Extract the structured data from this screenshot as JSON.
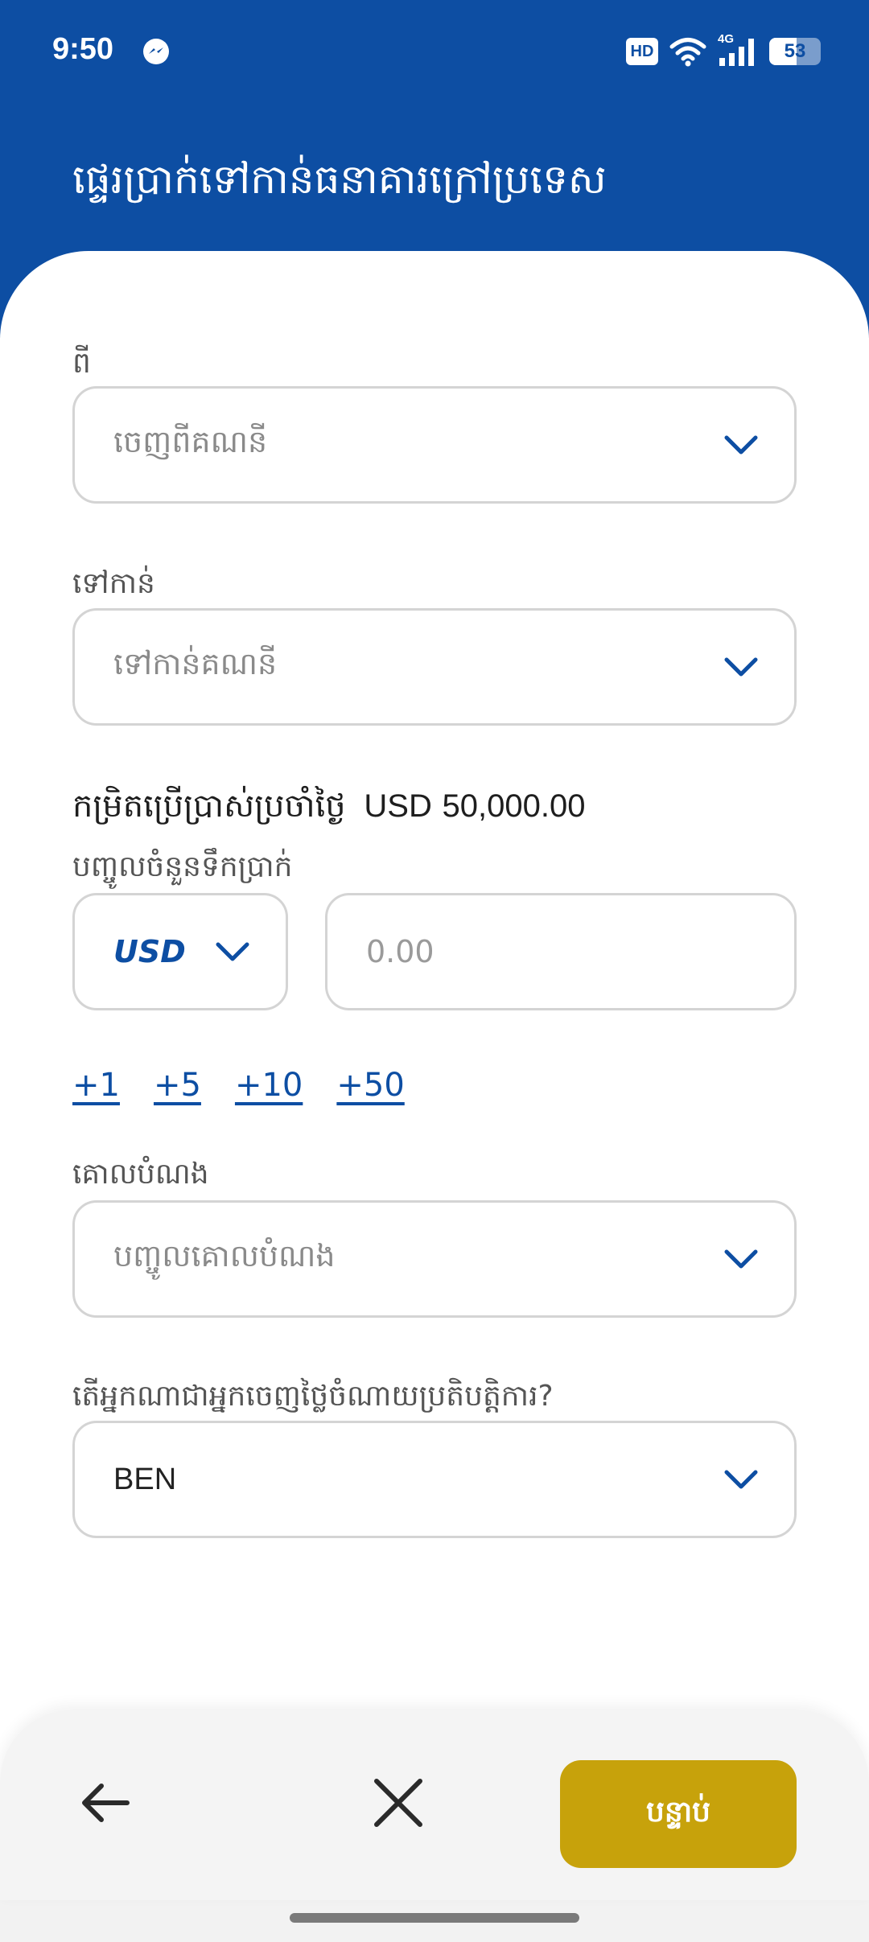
{
  "status_bar": {
    "time": "9:50",
    "hd_label": "HD",
    "network_label": "4G",
    "battery_level": "53",
    "battery_percent": 53
  },
  "header": {
    "title": "ផ្ទេរប្រាក់ទៅកាន់ធនាគារក្រៅប្រទេស",
    "background_color": "#0d4ea3"
  },
  "form": {
    "from": {
      "label": "ពី",
      "placeholder": "ចេញពីគណនី"
    },
    "to": {
      "label": "ទៅកាន់",
      "placeholder": "ទៅកាន់គណនី"
    },
    "limit": {
      "text": "កម្រិតប្រើប្រាស់ប្រចាំថ្ងៃ",
      "currency": "USD",
      "amount": "50,000.00"
    },
    "amount": {
      "label": "បញ្ចូលចំនួនទឹកប្រាក់",
      "currency": "USD",
      "placeholder": "0.00"
    },
    "quick_amounts": [
      "+1",
      "+5",
      "+10",
      "+50"
    ],
    "purpose": {
      "label": "គោលបំណង",
      "placeholder": "បញ្ចូលគោលបំណង"
    },
    "fee_payer": {
      "label": "តើអ្នកណាជាអ្នកចេញថ្លៃចំណាយប្រតិបត្តិការ?",
      "value": "BEN"
    }
  },
  "bottom_nav": {
    "back_icon": "arrow-left-icon",
    "close_icon": "close-icon",
    "next_label": "បន្ទាប់",
    "next_color": "#c7a20b"
  },
  "colors": {
    "accent": "#0d4ea3",
    "border": "#d4d4d4"
  }
}
